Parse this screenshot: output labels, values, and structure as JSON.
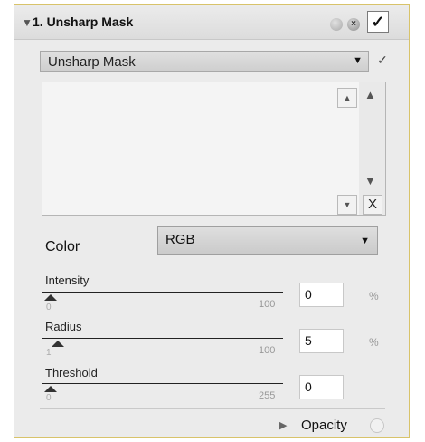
{
  "header": {
    "expand_icon": "▼",
    "title": "1. Unsharp Mask",
    "enable_check": "✓"
  },
  "filter": {
    "preset_value": "Unsharp Mask",
    "preset_check": "✓"
  },
  "list": {
    "items": [],
    "delete_label": "X"
  },
  "color": {
    "label": "Color",
    "value": "RGB"
  },
  "sliders": [
    {
      "label": "Intensity",
      "min": "0",
      "max": "100",
      "value": "0",
      "unit": "%"
    },
    {
      "label": "Radius",
      "min": "1",
      "max": "100",
      "value": "5",
      "unit": "%"
    },
    {
      "label": "Threshold",
      "min": "0",
      "max": "255",
      "value": "0",
      "unit": ""
    }
  ],
  "footer": {
    "opacity_label": "Opacity"
  },
  "colors": {
    "panel_border": "#d8c36a",
    "panel_bg": "#ebebeb"
  },
  "icons": [
    "collapse-triangle-icon",
    "reset-icon",
    "close-icon",
    "check-icon",
    "dropdown-arrow-icon",
    "scroll-up-icon",
    "scroll-down-icon",
    "expand-triangle-icon"
  ]
}
